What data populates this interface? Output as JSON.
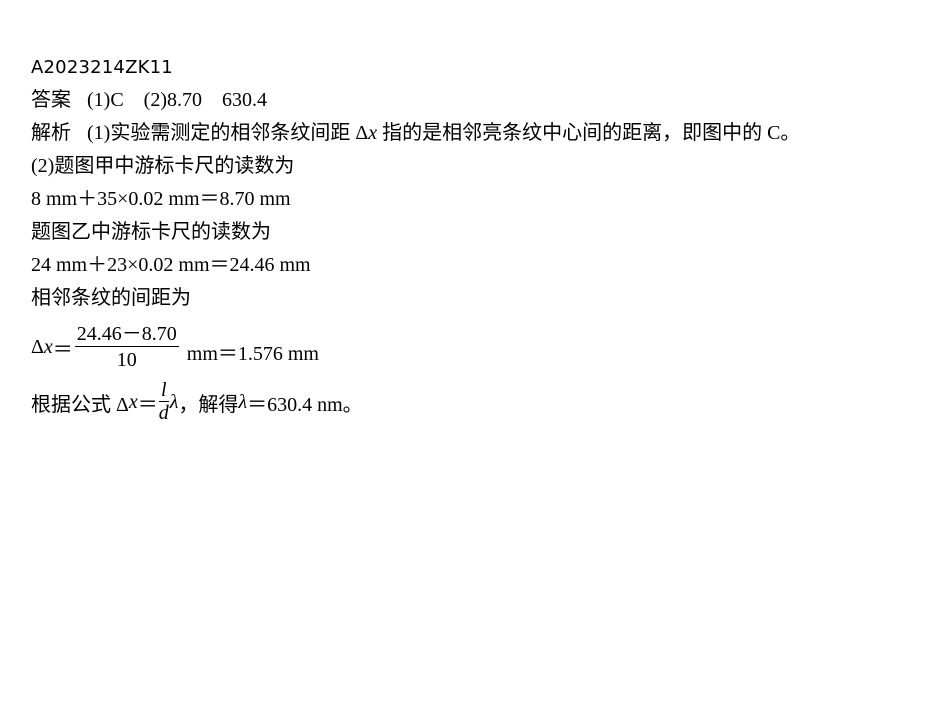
{
  "doc_id": "A2023214ZK11",
  "answer": {
    "label": "答案",
    "part1": "(1)C",
    "part2": "(2)8.70",
    "part2b": "630.4"
  },
  "analysis": {
    "label": "解析",
    "part1_text_a": "(1)实验需测定的相邻条纹间距 Δ",
    "part1_var": "x",
    "part1_text_b": " 指的是相邻亮条纹中心间的距离，即图中的 C。",
    "line2": "(2)题图甲中游标卡尺的读数为",
    "line3": "8 mm＋35×0.02 mm＝8.70 mm",
    "line4": "题图乙中游标卡尺的读数为",
    "line5": "24 mm＋23×0.02 mm＝24.46 mm",
    "line6": "相邻条纹的间距为",
    "eq1_lhs_delta": "Δ",
    "eq1_lhs_var": "x",
    "eq1_eq": "＝",
    "eq1_num": "24.46－8.70",
    "eq1_den": "10",
    "eq1_rhs": "mm＝1.576 mm",
    "eq2_prefix": "根据公式 Δ",
    "eq2_var": "x",
    "eq2_eq": "＝",
    "eq2_num": "l",
    "eq2_den": "d",
    "eq2_lambda": "λ",
    "eq2_mid": "，解得 ",
    "eq2_lambda2": "λ",
    "eq2_result": "＝630.4 nm。"
  }
}
